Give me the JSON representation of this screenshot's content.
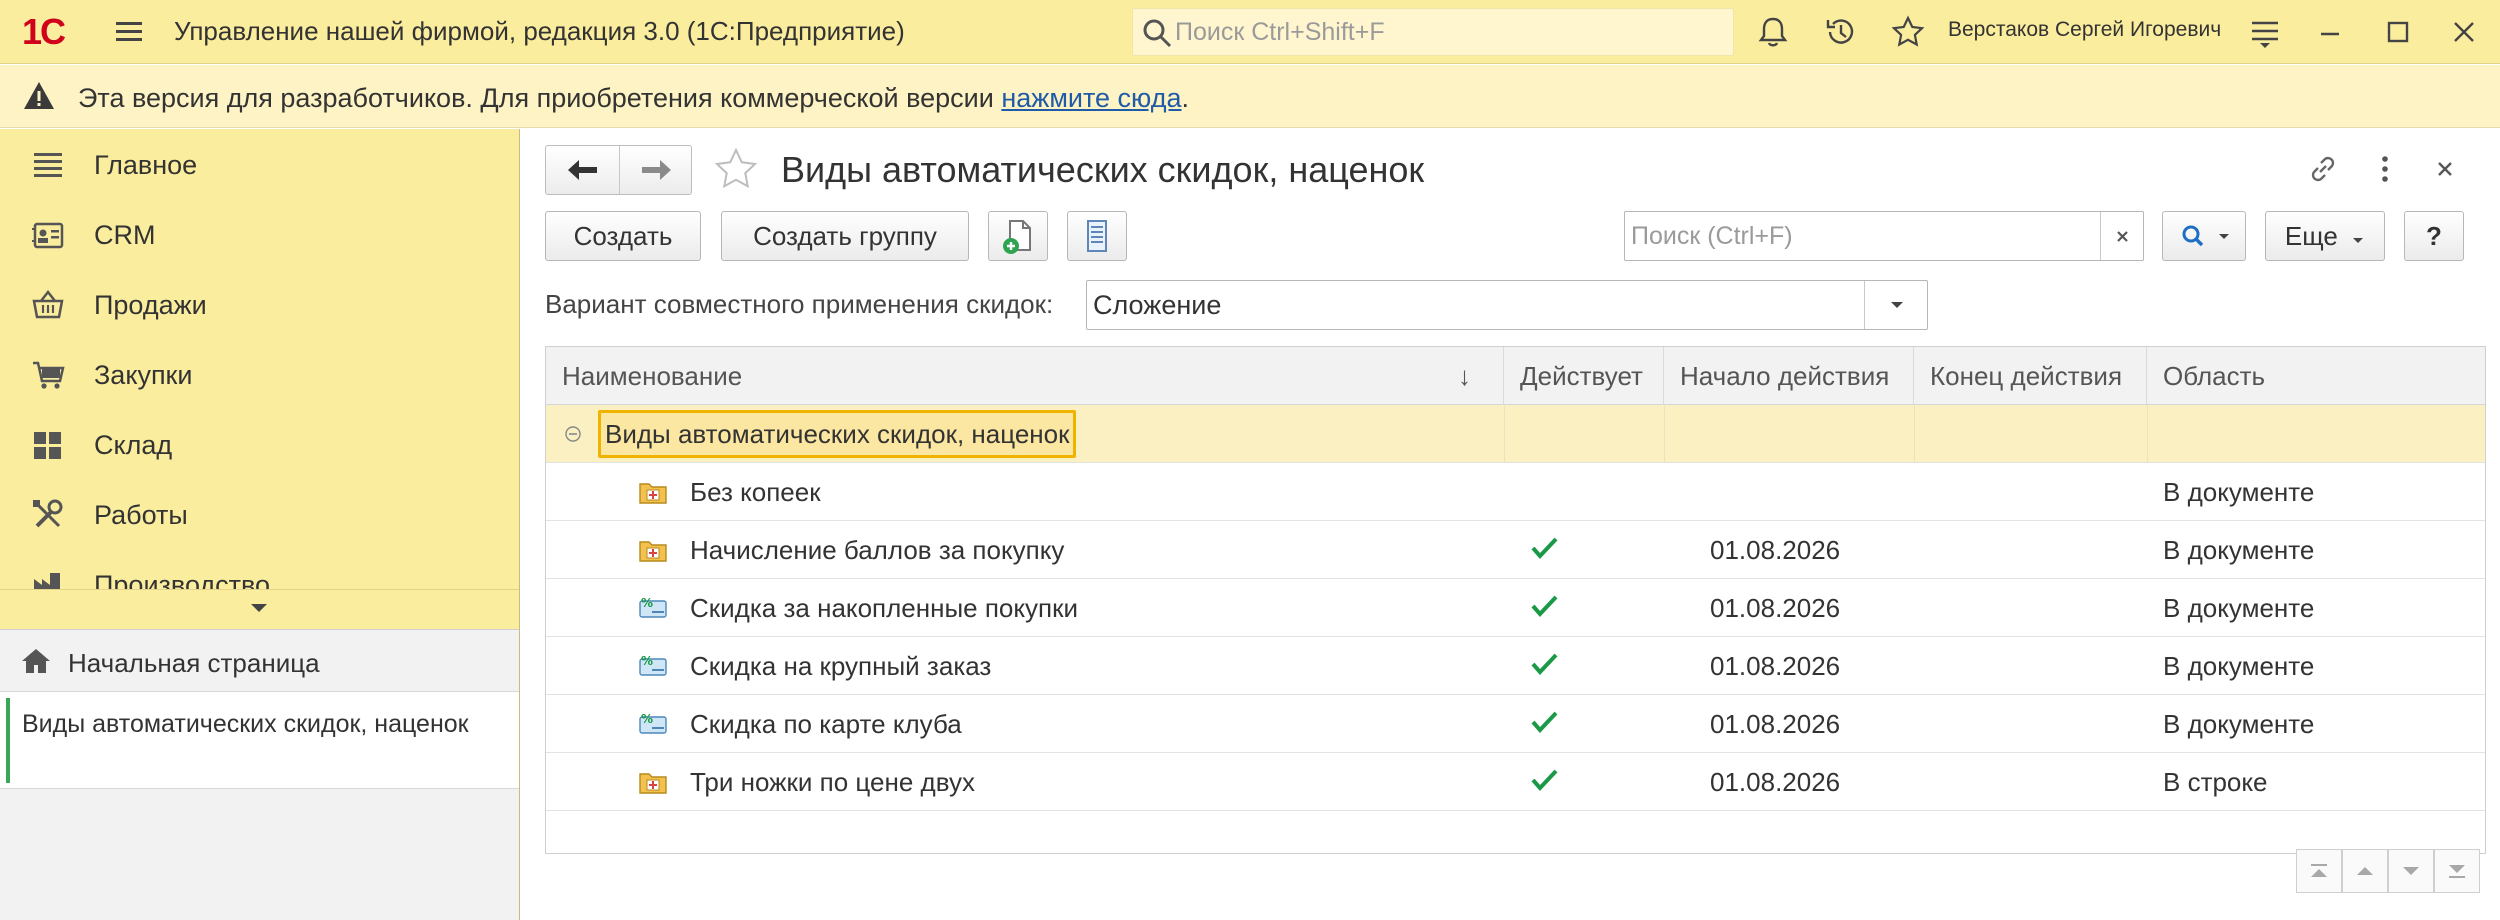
{
  "app": {
    "logo": "1С",
    "title": "Управление нашей фирмой, редакция 3.0  (1С:Предприятие)",
    "search_placeholder": "Поиск Ctrl+Shift+F",
    "user": "Верстаков Сергей Игоревич"
  },
  "banner": {
    "text": "Эта версия для разработчиков. Для приобретения коммерческой версии ",
    "link": "нажмите сюда",
    "suffix": "."
  },
  "sidebar": {
    "items": [
      {
        "label": "Главное",
        "icon": "list-icon"
      },
      {
        "label": "CRM",
        "icon": "contact-card-icon"
      },
      {
        "label": "Продажи",
        "icon": "basket-icon"
      },
      {
        "label": "Закупки",
        "icon": "cart-icon"
      },
      {
        "label": "Склад",
        "icon": "warehouse-icon"
      },
      {
        "label": "Работы",
        "icon": "tools-icon"
      },
      {
        "label": "Производство",
        "icon": "factory-icon"
      }
    ],
    "home": "Начальная страница",
    "open_document": "Виды автоматических скидок, наценок"
  },
  "main": {
    "title": "Виды автоматических скидок, наценок",
    "buttons": {
      "create": "Создать",
      "create_group": "Создать группу",
      "more": "Еще",
      "help": "?"
    },
    "search_placeholder": "Поиск (Ctrl+F)",
    "variant_label": "Вариант совместного применения скидок:",
    "variant_value": "Сложение",
    "table": {
      "columns": [
        "Наименование",
        "Действует",
        "Начало действия",
        "Конец действия",
        "Область"
      ],
      "sort_indicator": "↓",
      "group": "Виды автоматических скидок, наценок",
      "rows": [
        {
          "name": "Без копеек",
          "icon": "folder-plus-icon",
          "active": false,
          "start": "",
          "end": "",
          "scope": "В документе"
        },
        {
          "name": "Начисление баллов за покупку",
          "icon": "folder-plus-icon",
          "active": true,
          "start": "01.08.2026",
          "end": "",
          "scope": "В документе"
        },
        {
          "name": "Скидка за накопленные покупки",
          "icon": "discount-percent-icon",
          "active": true,
          "start": "01.08.2026",
          "end": "",
          "scope": "В документе"
        },
        {
          "name": "Скидка на крупный заказ",
          "icon": "discount-percent-icon",
          "active": true,
          "start": "01.08.2026",
          "end": "",
          "scope": "В документе"
        },
        {
          "name": "Скидка по карте клуба",
          "icon": "discount-percent-icon",
          "active": true,
          "start": "01.08.2026",
          "end": "",
          "scope": "В документе"
        },
        {
          "name": "Три ножки по цене двух",
          "icon": "folder-plus-icon",
          "active": true,
          "start": "01.08.2026",
          "end": "",
          "scope": "В строке"
        }
      ]
    }
  },
  "colors": {
    "accent_yellow": "#fbed9e",
    "highlight": "#f0b400",
    "check_green": "#1a9a47",
    "link_blue": "#1f5ba8"
  }
}
